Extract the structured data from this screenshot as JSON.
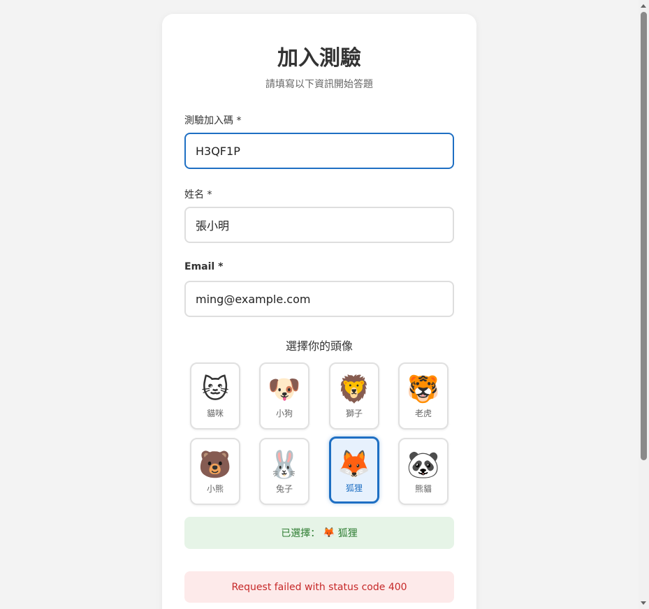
{
  "page": {
    "title": "加入測驗",
    "subtitle": "請填寫以下資訊開始答題"
  },
  "form": {
    "code": {
      "label": "測驗加入碼 *",
      "value": "H3QF1P"
    },
    "name": {
      "label": "姓名 *",
      "value": "張小明"
    },
    "email": {
      "label": "Email *",
      "value": "ming@example.com"
    }
  },
  "avatar_section": {
    "heading": "選擇你的頭像",
    "items": [
      {
        "emoji": "🐱",
        "label": "貓咪",
        "selected": false
      },
      {
        "emoji": "🐶",
        "label": "小狗",
        "selected": false
      },
      {
        "emoji": "🦁",
        "label": "獅子",
        "selected": false
      },
      {
        "emoji": "🐯",
        "label": "老虎",
        "selected": false
      },
      {
        "emoji": "🐻",
        "label": "小熊",
        "selected": false
      },
      {
        "emoji": "🐰",
        "label": "兔子",
        "selected": false
      },
      {
        "emoji": "🦊",
        "label": "狐狸",
        "selected": true
      },
      {
        "emoji": "🐼",
        "label": "熊貓",
        "selected": false
      }
    ]
  },
  "selection": {
    "prefix": "已選擇：",
    "emoji": "🦊",
    "name": "狐狸"
  },
  "error": {
    "message": "Request failed with status code 400"
  },
  "colors": {
    "accent": "#1e6fc3",
    "success_bg": "#e6f4e7",
    "success_text": "#2e7d32",
    "error_bg": "#fdeaea",
    "error_text": "#c62828"
  }
}
